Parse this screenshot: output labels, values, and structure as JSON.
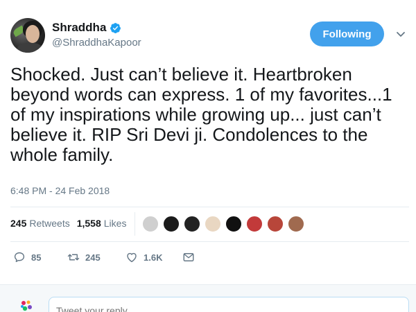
{
  "header": {
    "display_name": "Shraddha",
    "handle": "@ShraddhaKapoor",
    "verified_icon": "verified-badge-icon",
    "follow_label": "Following",
    "menu_icon": "chevron-down-icon",
    "accent_color": "#42a1ec"
  },
  "tweet": {
    "text": "Shocked. Just can’t believe it. Heartbroken beyond words can express. 1 of my favorites...1 of my inspirations while growing up... just can’t believe it. RIP Sri Devi ji. Condolences to the whole family.",
    "timestamp": "6:48 PM - 24 Feb 2018"
  },
  "stats": {
    "retweets_count": "245",
    "retweets_label": "Retweets",
    "likes_count": "1,558",
    "likes_label": "Likes"
  },
  "likers": [
    {
      "icon": "user-avatar",
      "color": "#cfcfcf"
    },
    {
      "icon": "user-avatar",
      "color": "#1b1b1b"
    },
    {
      "icon": "user-avatar",
      "color": "#222222"
    },
    {
      "icon": "user-avatar",
      "color": "#e9d7c2"
    },
    {
      "icon": "user-avatar",
      "color": "#111111"
    },
    {
      "icon": "user-avatar",
      "color": "#c23a3a"
    },
    {
      "icon": "user-avatar",
      "color": "#b8463a"
    },
    {
      "icon": "user-avatar",
      "color": "#a06a4f"
    }
  ],
  "actions": {
    "reply_count": "85",
    "retweet_count": "245",
    "like_count": "1.6K"
  },
  "reply": {
    "placeholder": "Tweet your reply"
  }
}
